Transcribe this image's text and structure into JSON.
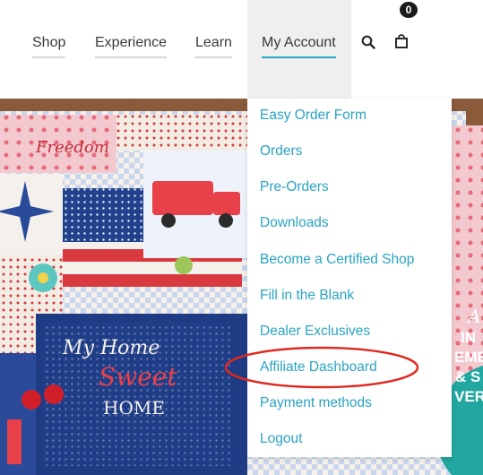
{
  "nav": {
    "items": [
      {
        "label": "Shop"
      },
      {
        "label": "Experience"
      },
      {
        "label": "Learn"
      },
      {
        "label": "My Account"
      }
    ]
  },
  "cart": {
    "count": "0"
  },
  "icons": {
    "search": "search-icon",
    "bag": "shopping-bag-icon"
  },
  "account_menu": {
    "items": [
      {
        "label": "Easy Order Form"
      },
      {
        "label": "Orders"
      },
      {
        "label": "Pre-Orders"
      },
      {
        "label": "Downloads"
      },
      {
        "label": "Become a Certified Shop"
      },
      {
        "label": "Fill in the Blank"
      },
      {
        "label": "Dealer Exclusives"
      },
      {
        "label": "Affiliate Dashboard"
      },
      {
        "label": "Payment methods"
      },
      {
        "label": "Logout"
      }
    ]
  },
  "hero": {
    "quilt_text_1": "Freedom",
    "quilt_text_2": "My Home",
    "quilt_text_3": "Sweet",
    "quilt_text_4": "HOME",
    "badge_lines": [
      "A",
      "IN",
      "EME",
      "& S",
      "VER"
    ]
  },
  "colors": {
    "accent": "#2aa6c5",
    "menu_text": "#2aa3c2",
    "nav_text": "#3a3a3a",
    "annotation": "#e0281e"
  }
}
